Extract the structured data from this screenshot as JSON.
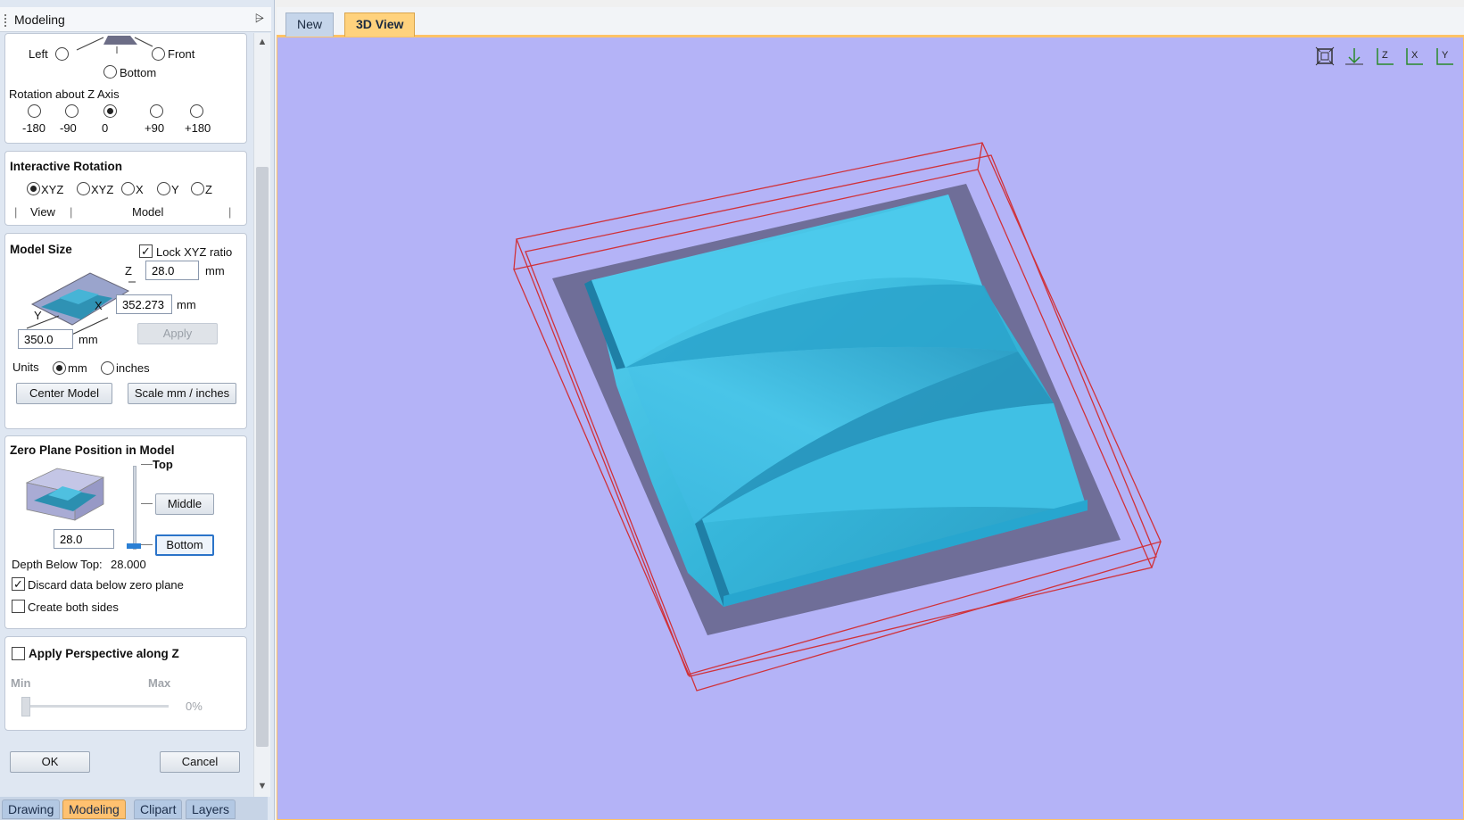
{
  "panel": {
    "title": "Modeling",
    "pin_glyph": "📌"
  },
  "orientation": {
    "left": "Left",
    "front": "Front",
    "bottom": "Bottom",
    "rotation_label": "Rotation about Z Axis",
    "rotation_options": [
      "-180",
      "-90",
      "0",
      "+90",
      "+180"
    ],
    "rotation_selected": "0"
  },
  "interactive_rotation": {
    "title": "Interactive Rotation",
    "options": [
      "XYZ",
      "XYZ",
      "X",
      "Y",
      "Z"
    ],
    "selected_index": 0,
    "view_label": "View",
    "model_label": "Model"
  },
  "model_size": {
    "title": "Model Size",
    "lock_label": "Lock XYZ ratio",
    "lock_checked": true,
    "z_axis": "Z",
    "x_axis": "X",
    "y_axis": "Y",
    "z_value": "28.0",
    "x_value": "352.273",
    "y_value": "350.0",
    "unit_mm": "mm",
    "apply_label": "Apply",
    "units_label": "Units",
    "units_mm": "mm",
    "units_inches": "inches",
    "units_selected": "mm",
    "center_label": "Center Model",
    "scale_label": "Scale mm / inches"
  },
  "zero_plane": {
    "title": "Zero Plane Position in Model",
    "top_label": "Top",
    "middle_label": "Middle",
    "bottom_label": "Bottom",
    "value": "28.0",
    "depth_label": "Depth Below Top:",
    "depth_value": "28.000",
    "discard_label": "Discard data below zero plane",
    "discard_checked": true,
    "both_sides_label": "Create both sides",
    "both_sides_checked": false
  },
  "perspective": {
    "title": "Apply Perspective along Z",
    "checked": false,
    "min_label": "Min",
    "max_label": "Max",
    "value_label": "0%"
  },
  "dialog": {
    "ok_label": "OK",
    "cancel_label": "Cancel"
  },
  "bottom_tabs": [
    {
      "label": "Drawing",
      "active": false
    },
    {
      "label": "Modeling",
      "active": true
    },
    {
      "label": "Clipart",
      "active": false
    },
    {
      "label": "Layers",
      "active": false
    }
  ],
  "doc_tabs": [
    {
      "label": "New",
      "active": false
    },
    {
      "label": "3D View",
      "active": true
    }
  ],
  "view_toolbar": {
    "icons": [
      "fit-view-icon",
      "view-down-z-icon",
      "view-z-icon",
      "view-x-icon",
      "view-y-icon"
    ],
    "labels": [
      "⛶",
      "Z",
      "Z",
      "X",
      "Y"
    ]
  },
  "colors": {
    "viewport_bg": "#b4b3f7",
    "model_cyan": "#3fc3e6",
    "base_plate": "#6f6e98",
    "bounding_box": "#d0323a",
    "active_tab": "#ffc170"
  }
}
